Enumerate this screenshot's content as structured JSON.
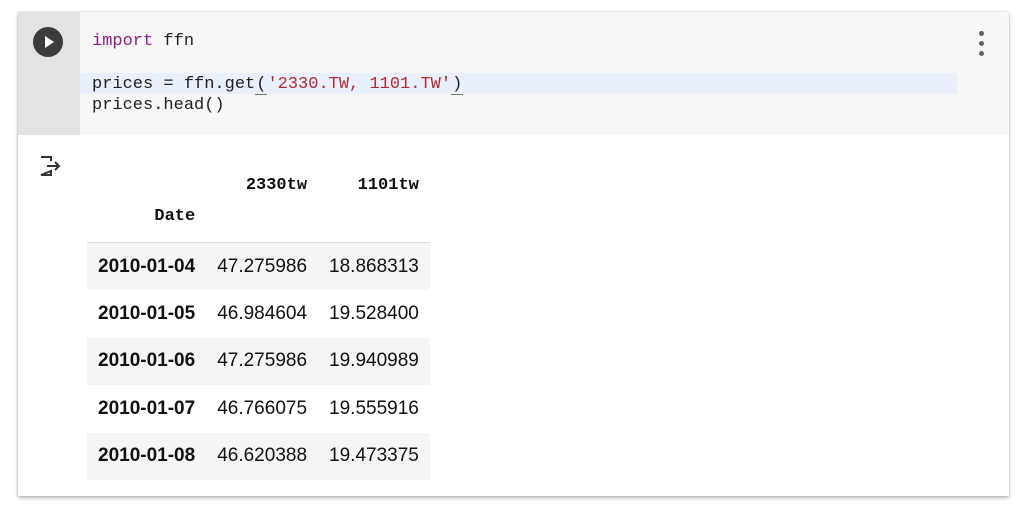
{
  "cell": {
    "code_lines": [
      {
        "keyword": "import",
        "rest": " ffn"
      },
      {
        "text": "prices = ffn.get",
        "open_paren": "(",
        "string": "'2330.TW, 1101.TW'",
        "close_paren": ")"
      },
      {
        "text": "prices.head()"
      }
    ]
  },
  "output": {
    "columns": [
      "2330tw",
      "1101tw"
    ],
    "index_name": "Date",
    "rows": [
      {
        "date": "2010-01-04",
        "values": [
          "47.275986",
          "18.868313"
        ]
      },
      {
        "date": "2010-01-05",
        "values": [
          "46.984604",
          "19.528400"
        ]
      },
      {
        "date": "2010-01-06",
        "values": [
          "47.275986",
          "19.940989"
        ]
      },
      {
        "date": "2010-01-07",
        "values": [
          "46.766075",
          "19.555916"
        ]
      },
      {
        "date": "2010-01-08",
        "values": [
          "46.620388",
          "19.473375"
        ]
      }
    ]
  },
  "icons": {
    "run": "play-icon",
    "menu": "more-vert-icon",
    "output": "output-arrow-icon"
  },
  "colors": {
    "gutter": "#e3e3e3",
    "editor_bg": "#f7f7f7",
    "keyword": "#8b1e8b",
    "string": "#b22b31",
    "row_stripe": "#f5f5f5"
  }
}
